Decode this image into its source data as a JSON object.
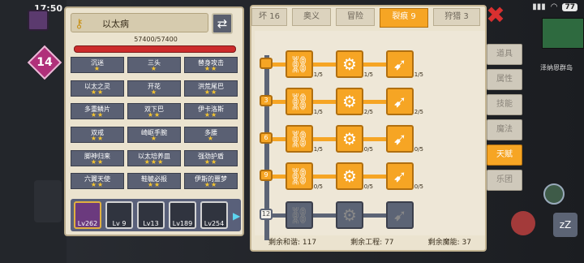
{
  "status_bar": {
    "time": "17:50",
    "battery": "77"
  },
  "hero": {
    "level_badge": "14",
    "name": "以太病",
    "hp": "57400/57400",
    "hp_fraction": 1.0
  },
  "traits": [
    {
      "name": "沉迷",
      "stars": "★"
    },
    {
      "name": "三头",
      "stars": "★"
    },
    {
      "name": "替身攻击",
      "stars": "★★"
    },
    {
      "name": "以太之灵",
      "stars": "★★"
    },
    {
      "name": "开花",
      "stars": "★"
    },
    {
      "name": "洪荒尾巴",
      "stars": "★★"
    },
    {
      "name": "多重鳞片",
      "stars": "★★"
    },
    {
      "name": "双下巴",
      "stars": "★★"
    },
    {
      "name": "伊卡洛斯",
      "stars": "★★"
    },
    {
      "name": "双戒",
      "stars": "★★"
    },
    {
      "name": "崎岖手腕",
      "stars": "★"
    },
    {
      "name": "多腰",
      "stars": "★"
    },
    {
      "name": "脚神归来",
      "stars": "★★"
    },
    {
      "name": "以太培养皿",
      "stars": "★★★"
    },
    {
      "name": "强劲护盾",
      "stars": "★★"
    },
    {
      "name": "六翼天使",
      "stars": "★★"
    },
    {
      "name": "鞋毓必报",
      "stars": "★★"
    },
    {
      "name": "伊斯的噩梦",
      "stars": "★★"
    }
  ],
  "portraits": [
    {
      "level": "Lv262"
    },
    {
      "level": "Lv 9"
    },
    {
      "level": "Lv13"
    },
    {
      "level": "Lv189"
    },
    {
      "level": "Lv254"
    }
  ],
  "tabs": [
    "坏 16",
    "奥义",
    "冒险",
    "裂痕 9",
    "狩猎 3"
  ],
  "active_tab": "裂痕 9",
  "tier_nodes": [
    "",
    "3",
    "6",
    "9",
    "12"
  ],
  "skill_rows": [
    {
      "counts": [
        "1/5",
        "1/5",
        "1/5"
      ],
      "locked": false
    },
    {
      "counts": [
        "1/5",
        "2/5",
        "2/5"
      ],
      "locked": false
    },
    {
      "counts": [
        "1/5",
        "0/5",
        "0/5"
      ],
      "locked": false
    },
    {
      "counts": [
        "0/5",
        "0/5",
        "0/5"
      ],
      "locked": false
    },
    {
      "counts": [
        "",
        "",
        ""
      ],
      "locked": true
    }
  ],
  "footer": {
    "harmony": "剩余和谐: 117",
    "engineering": "剩余工程: 77",
    "magic": "剩余魔能: 37"
  },
  "side_menu": [
    "道具",
    "属性",
    "技能",
    "魔法",
    "天赋",
    "乐团"
  ],
  "active_side": "天赋",
  "minimap_label": "泽纳恩群岛",
  "colors": {
    "accent": "#f6a524",
    "panel": "#ebe3cf",
    "slate": "#5c6475",
    "hp": "#cc2b2b"
  }
}
